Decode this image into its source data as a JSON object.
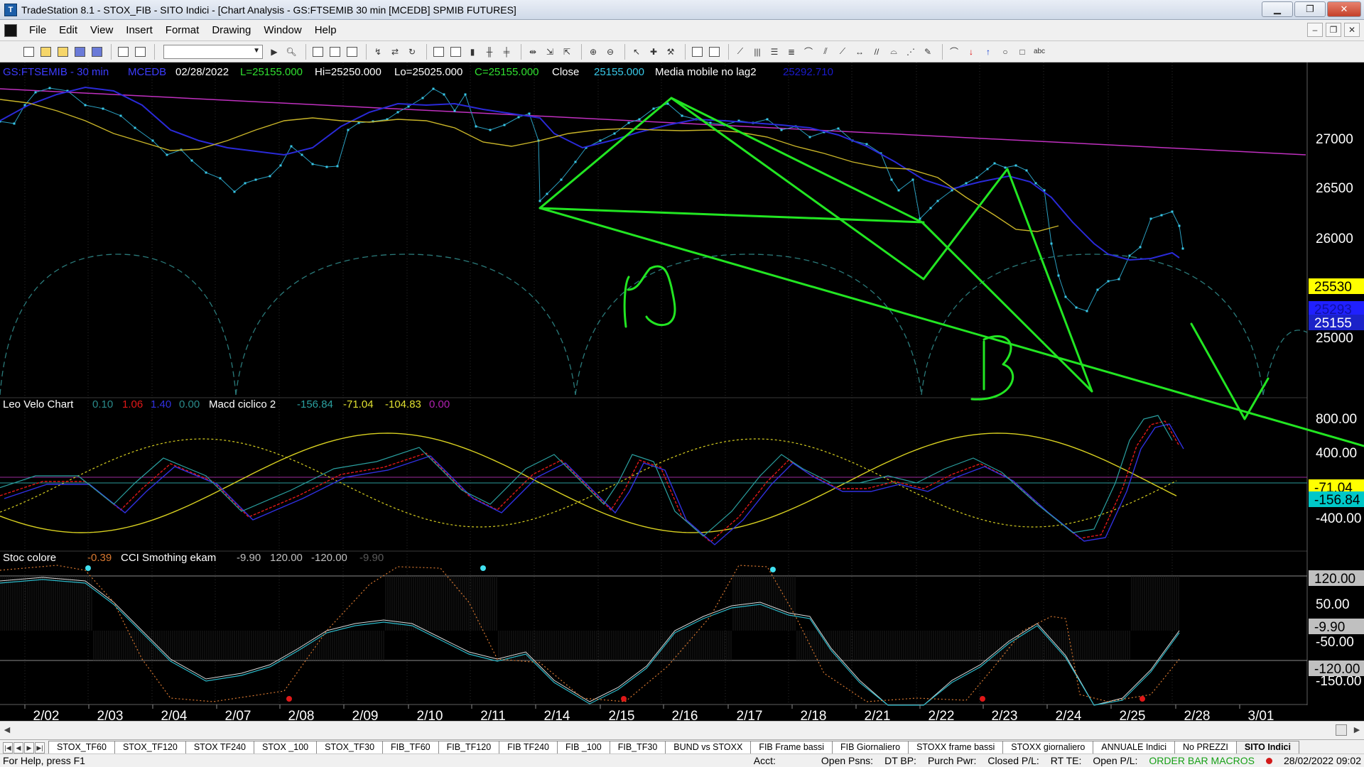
{
  "window": {
    "title": "TradeStation 8.1 - STOX_FIB - SITO Indici - [Chart Analysis - GS:FTSEMIB  30 min  [MCEDB] SPMIB FUTURES]"
  },
  "menu": [
    "File",
    "Edit",
    "View",
    "Insert",
    "Format",
    "Drawing",
    "Window",
    "Help"
  ],
  "chart_header": {
    "symbol": "GS:FTSEMIB - 30 min",
    "feed": "MCEDB",
    "date": "02/28/2022",
    "last": "L=25155.000",
    "high": "Hi=25250.000",
    "low": "Lo=25025.000",
    "close": "C=25155.000",
    "close_label": "Close",
    "close_value": "25155.000",
    "ma_label": "Media mobile no lag2",
    "ma_value": "25292.710"
  },
  "panel2_header": {
    "name": "Leo Velo Chart",
    "v1": "0.10",
    "v2": "1.06",
    "v3": "1.40",
    "v4": "0.00",
    "name2": "Macd ciclico 2",
    "v5": "-156.84",
    "v6": "-71.04",
    "v7": "-104.83",
    "v8": "0.00"
  },
  "panel3_header": {
    "name": "Stoc colore",
    "v1": "-0.39",
    "name2": "CCI Smothing ekam",
    "v2": "-9.90",
    "v3": "120.00",
    "v4": "-120.00",
    "v5": "-9.90"
  },
  "price_axis": {
    "ticks": [
      "27000",
      "26500",
      "26000",
      "25000"
    ],
    "markers": [
      {
        "label": "25530",
        "bg": "#ffff00",
        "fg": "#000000"
      },
      {
        "label": "25293",
        "bg": "#2020ff",
        "fg": "#1010a0"
      },
      {
        "label": "25155",
        "bg": "#1b22c8",
        "fg": "#ffffff"
      }
    ]
  },
  "macd_axis": {
    "ticks": [
      "800.00",
      "400.00",
      "-400.00"
    ],
    "markers": [
      {
        "label": "-71.04",
        "bg": "#ffff00",
        "fg": "#000000"
      },
      {
        "label": "-156.84",
        "bg": "#00c8c8",
        "fg": "#000000"
      }
    ]
  },
  "cci_axis": {
    "ticks": [
      "50.00",
      "-50.00",
      "-150.00"
    ],
    "markers": [
      {
        "label": "120.00",
        "bg": "#c0c0c0",
        "fg": "#000000"
      },
      {
        "label": "-9.90",
        "bg": "#c0c0c0",
        "fg": "#000000"
      },
      {
        "label": "-120.00",
        "bg": "#c0c0c0",
        "fg": "#000000"
      }
    ]
  },
  "date_axis": [
    "2/02",
    "2/03",
    "2/04",
    "2/07",
    "2/08",
    "2/09",
    "2/10",
    "2/11",
    "2/14",
    "2/15",
    "2/16",
    "2/17",
    "2/18",
    "2/21",
    "2/22",
    "2/23",
    "2/24",
    "2/25",
    "2/28",
    "3/01"
  ],
  "annotations": [
    "A",
    "B"
  ],
  "tabs": [
    "STOX_TF60",
    "STOX_TF120",
    "STOX TF240",
    "STOX _100",
    "STOX_TF30",
    "FIB_TF60",
    "FIB_TF120",
    "FIB TF240",
    "FIB _100",
    "FIB_TF30",
    "BUND vs STOXX",
    "FIB Frame bassi",
    "FIB Giornaliero",
    "STOXX frame bassi",
    "STOXX giornaliero",
    "ANNUALE Indici",
    "No PREZZI",
    "SITO Indici"
  ],
  "active_tab": "SITO Indici",
  "status": {
    "help": "For Help, press F1",
    "acct": "Acct:",
    "open_psns": "Open Psns:",
    "dt_bp": "DT BP:",
    "purch_pwr": "Purch Pwr:",
    "closed_pl": "Closed P/L:",
    "rt_te": "RT TE:",
    "open_pl": "Open P/L:",
    "macros": "ORDER BAR  MACROS",
    "datetime": "28/02/2022 09:02"
  },
  "colors": {
    "price_dots": "#38c8e8",
    "ma_blue": "#2a2ad8",
    "ma_yellow": "#c8b428",
    "trend_magenta": "#c030c0",
    "drawing_green": "#22e622",
    "cycle_dash": "#2a7a7a"
  }
}
